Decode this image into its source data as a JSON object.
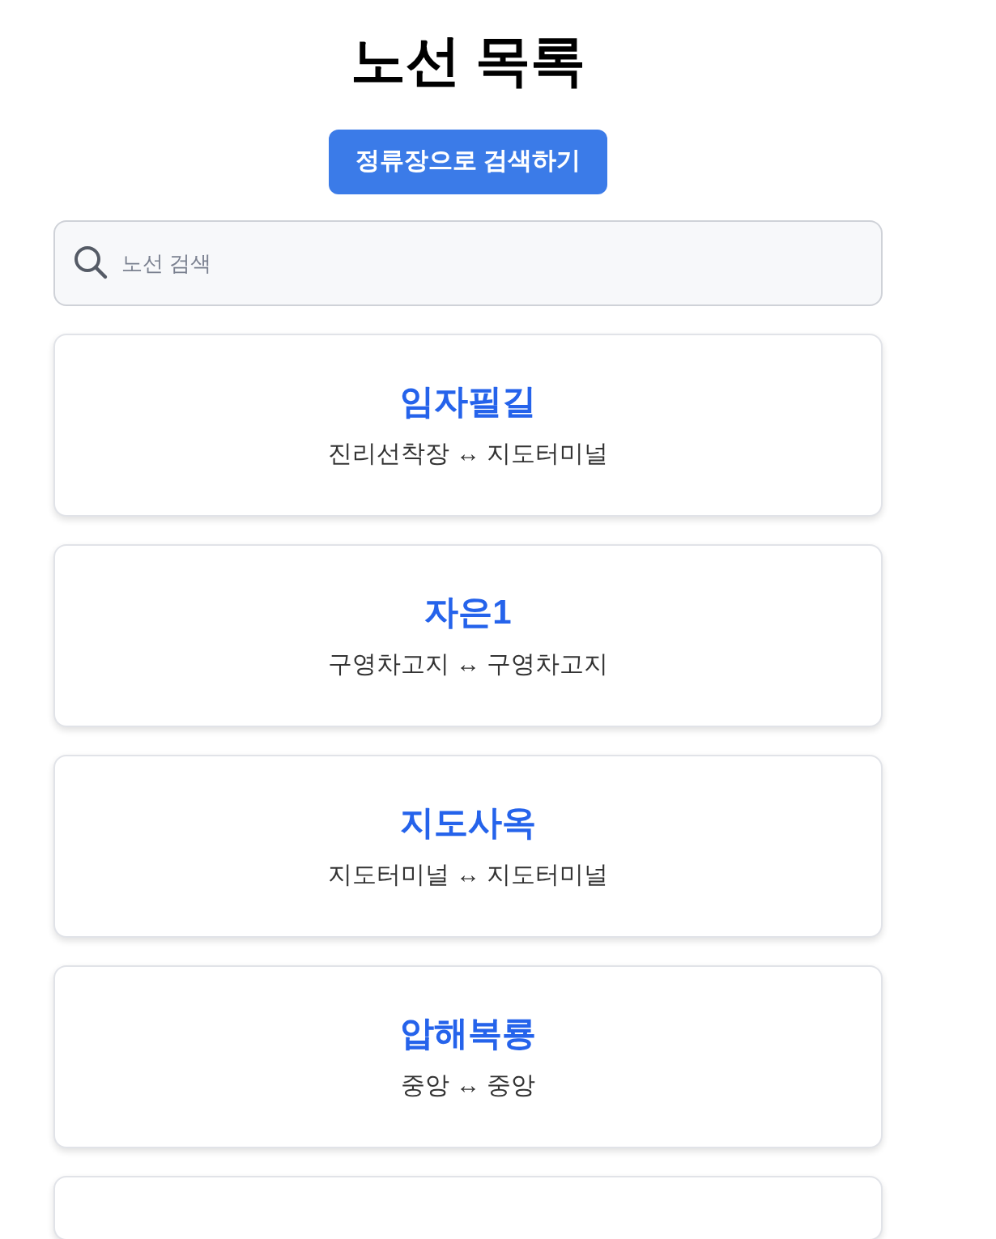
{
  "title": "노선 목록",
  "stop_search_button": "정류장으로 검색하기",
  "search": {
    "placeholder": "노선 검색"
  },
  "routes": [
    {
      "name": "임자필길",
      "route": "진리선착장 ↔ 지도터미널"
    },
    {
      "name": "자은1",
      "route": "구영차고지 ↔ 구영차고지"
    },
    {
      "name": "지도사옥",
      "route": "지도터미널 ↔ 지도터미널"
    },
    {
      "name": "압해복룡",
      "route": "중앙 ↔ 중앙"
    }
  ],
  "more_below": true
}
